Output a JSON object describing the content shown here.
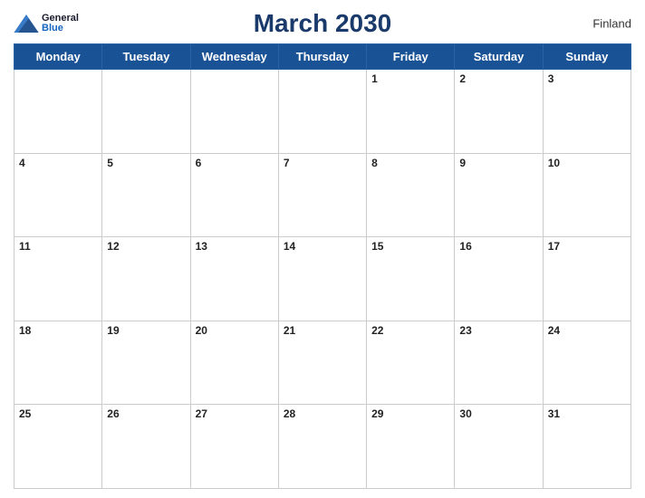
{
  "header": {
    "title": "March 2030",
    "country": "Finland",
    "logo_general": "General",
    "logo_blue": "Blue"
  },
  "days_of_week": [
    "Monday",
    "Tuesday",
    "Wednesday",
    "Thursday",
    "Friday",
    "Saturday",
    "Sunday"
  ],
  "weeks": [
    [
      null,
      null,
      null,
      null,
      1,
      2,
      3
    ],
    [
      4,
      5,
      6,
      7,
      8,
      9,
      10
    ],
    [
      11,
      12,
      13,
      14,
      15,
      16,
      17
    ],
    [
      18,
      19,
      20,
      21,
      22,
      23,
      24
    ],
    [
      25,
      26,
      27,
      28,
      29,
      30,
      31
    ]
  ]
}
